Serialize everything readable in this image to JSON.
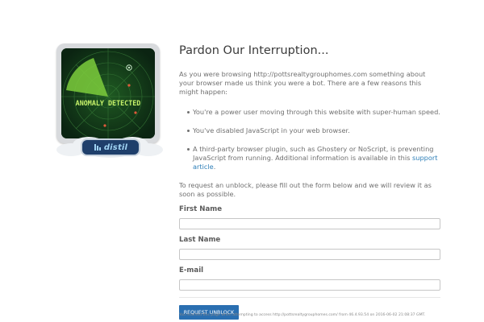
{
  "illustration": {
    "radar_text": "ANOMALY DETECTED",
    "badge_text": "distil",
    "colors": {
      "screen": "#0d2a15",
      "sweep": "#6fbf3a",
      "grid": "#3a7a3a",
      "blip": "#e05a3a",
      "badge": "#1f3f6b"
    }
  },
  "content": {
    "title": "Pardon Our Interruption...",
    "intro": "As you were browsing http://pottsrealtygrouphomes.com something about your browser made us think you were a bot. There are a few reasons this might happen:",
    "reasons": [
      {
        "text": "You're a power user moving through this website with super-human speed."
      },
      {
        "text": "You've disabled JavaScript in your web browser."
      },
      {
        "text": "A third-party browser plugin, such as Ghostery or NoScript, is preventing JavaScript from running. Additional information is available in this ",
        "link": "support article",
        "suffix": "."
      }
    ],
    "request_text": "To request an unblock, please fill out the form below and we will review it as soon as possible."
  },
  "form": {
    "first_name_label": "First Name",
    "last_name_label": "Last Name",
    "email_label": "E-mail",
    "first_name_value": "",
    "last_name_value": "",
    "email_value": "",
    "submit_label": "REQUEST UNBLOCK"
  },
  "footer": {
    "note": "You reached this page when attempting to access http://pottsrealtygrouphomes.com/ from 46.4.93.54 on 2016-06-02 21:08:37 GMT."
  }
}
